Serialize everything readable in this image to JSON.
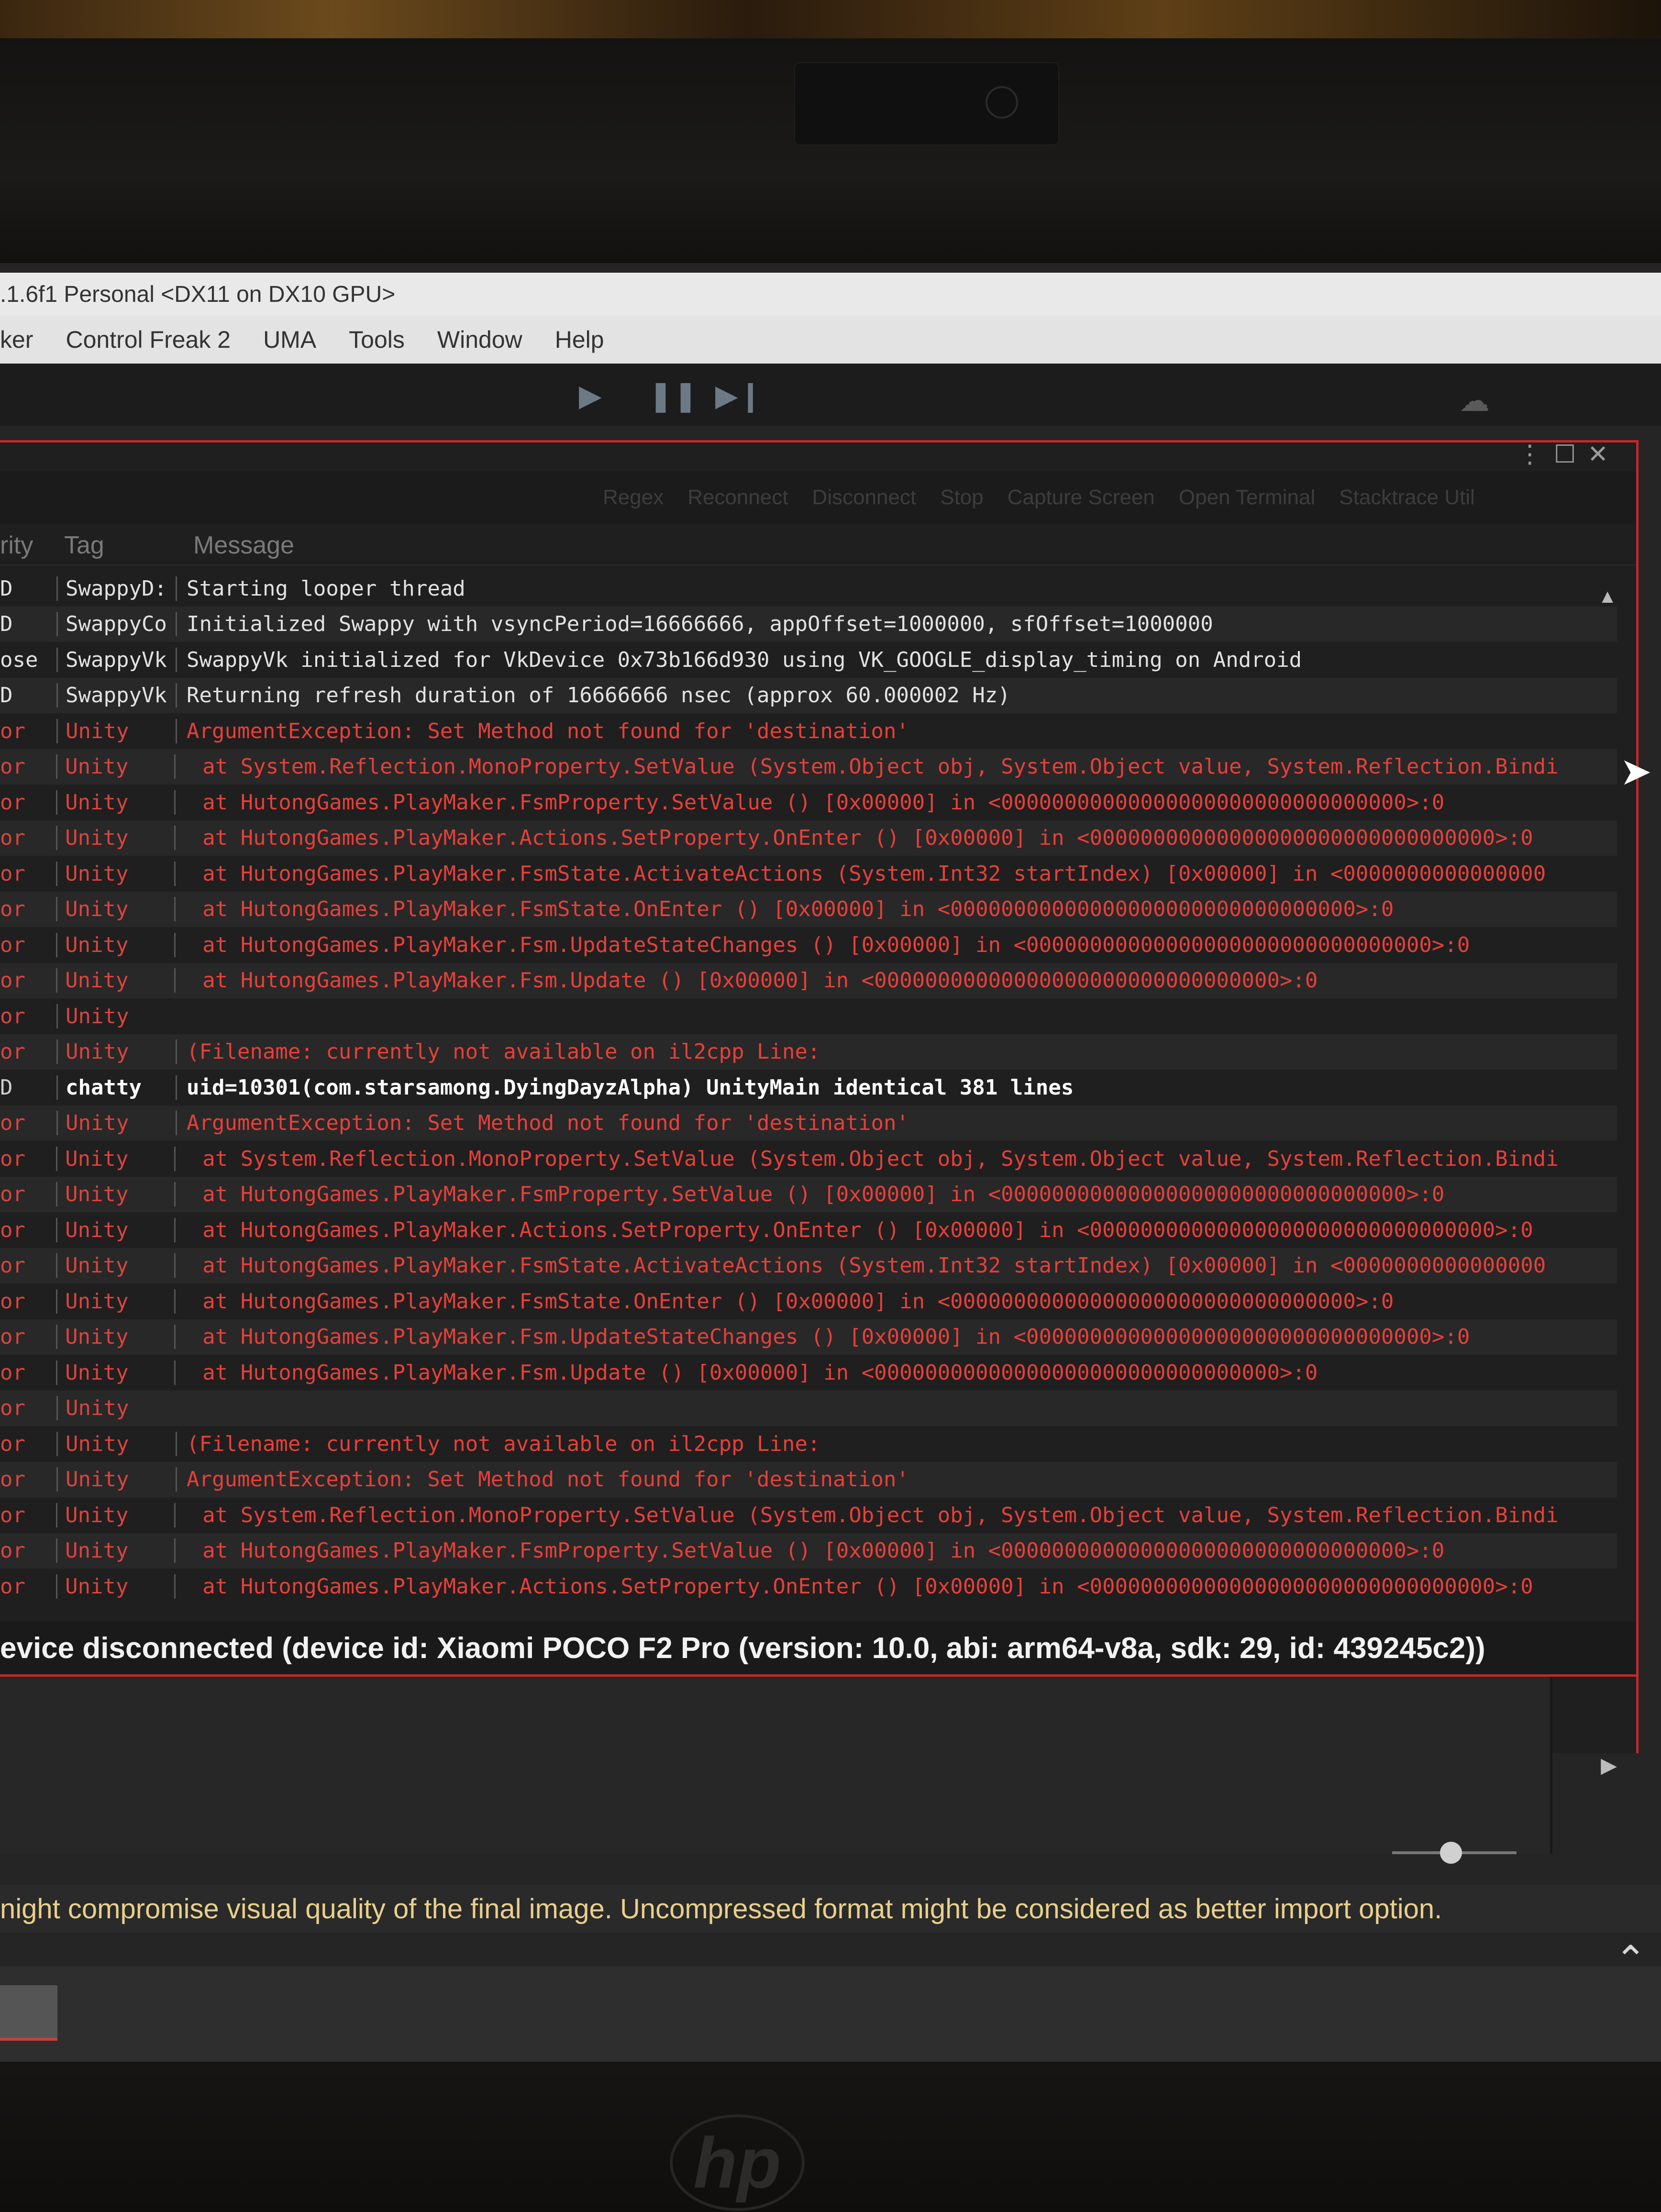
{
  "window": {
    "title": ".1.6f1 Personal <DX11 on DX10 GPU>"
  },
  "menu": [
    "ker",
    "Control Freak 2",
    "UMA",
    "Tools",
    "Window",
    "Help"
  ],
  "logcat": {
    "columns": {
      "priority": "rity",
      "tag": "Tag",
      "message": "Message"
    },
    "toolbar_buttons": [
      "Regex",
      "Reconnect",
      "Disconnect",
      "Stop",
      "Capture Screen",
      "Open Terminal",
      "Stacktrace Util"
    ],
    "rows": [
      {
        "p": "D",
        "tag": "SwappyD:",
        "msg": "Starting looper thread",
        "kind": "info",
        "indent": false
      },
      {
        "p": "D",
        "tag": "SwappyCo",
        "msg": "Initialized Swappy with vsyncPeriod=16666666, appOffset=1000000, sfOffset=1000000",
        "kind": "info",
        "indent": false
      },
      {
        "p": "ose",
        "tag": "SwappyVk",
        "msg": "SwappyVk initialized for VkDevice 0x73b166d930 using VK_GOOGLE_display_timing on Android",
        "kind": "info",
        "indent": false
      },
      {
        "p": "D",
        "tag": "SwappyVk",
        "msg": "Returning refresh duration of 16666666 nsec (approx 60.000002 Hz)",
        "kind": "info",
        "indent": false
      },
      {
        "p": "or",
        "tag": "Unity",
        "msg": "ArgumentException: Set Method not found for 'destination'",
        "kind": "err",
        "indent": false
      },
      {
        "p": "or",
        "tag": "Unity",
        "msg": "at System.Reflection.MonoProperty.SetValue (System.Object obj, System.Object value, System.Reflection.Bindi",
        "kind": "err",
        "indent": true
      },
      {
        "p": "or",
        "tag": "Unity",
        "msg": "at HutongGames.PlayMaker.FsmProperty.SetValue () [0x00000] in <00000000000000000000000000000000>:0",
        "kind": "err",
        "indent": true
      },
      {
        "p": "or",
        "tag": "Unity",
        "msg": "at HutongGames.PlayMaker.Actions.SetProperty.OnEnter () [0x00000] in <00000000000000000000000000000000>:0",
        "kind": "err",
        "indent": true
      },
      {
        "p": "or",
        "tag": "Unity",
        "msg": "at HutongGames.PlayMaker.FsmState.ActivateActions (System.Int32 startIndex) [0x00000] in <0000000000000000",
        "kind": "err",
        "indent": true
      },
      {
        "p": "or",
        "tag": "Unity",
        "msg": "at HutongGames.PlayMaker.FsmState.OnEnter () [0x00000] in <00000000000000000000000000000000>:0",
        "kind": "err",
        "indent": true
      },
      {
        "p": "or",
        "tag": "Unity",
        "msg": "at HutongGames.PlayMaker.Fsm.UpdateStateChanges () [0x00000] in <00000000000000000000000000000000>:0",
        "kind": "err",
        "indent": true
      },
      {
        "p": "or",
        "tag": "Unity",
        "msg": "at HutongGames.PlayMaker.Fsm.Update () [0x00000] in <00000000000000000000000000000000>:0",
        "kind": "err",
        "indent": true
      },
      {
        "p": "or",
        "tag": "Unity",
        "msg": "",
        "kind": "err",
        "indent": false
      },
      {
        "p": "or",
        "tag": "Unity",
        "msg": "(Filename: currently not available on il2cpp Line:",
        "kind": "err",
        "indent": false
      },
      {
        "p": "D",
        "tag": "chatty",
        "msg": "uid=10301(com.starsamong.DyingDayzAlpha) UnityMain identical 381 lines",
        "kind": "chatty",
        "indent": false
      },
      {
        "p": "or",
        "tag": "Unity",
        "msg": "ArgumentException: Set Method not found for 'destination'",
        "kind": "err",
        "indent": false
      },
      {
        "p": "or",
        "tag": "Unity",
        "msg": "at System.Reflection.MonoProperty.SetValue (System.Object obj, System.Object value, System.Reflection.Bindi",
        "kind": "err",
        "indent": true
      },
      {
        "p": "or",
        "tag": "Unity",
        "msg": "at HutongGames.PlayMaker.FsmProperty.SetValue () [0x00000] in <00000000000000000000000000000000>:0",
        "kind": "err",
        "indent": true
      },
      {
        "p": "or",
        "tag": "Unity",
        "msg": "at HutongGames.PlayMaker.Actions.SetProperty.OnEnter () [0x00000] in <00000000000000000000000000000000>:0",
        "kind": "err",
        "indent": true
      },
      {
        "p": "or",
        "tag": "Unity",
        "msg": "at HutongGames.PlayMaker.FsmState.ActivateActions (System.Int32 startIndex) [0x00000] in <0000000000000000",
        "kind": "err",
        "indent": true
      },
      {
        "p": "or",
        "tag": "Unity",
        "msg": "at HutongGames.PlayMaker.FsmState.OnEnter () [0x00000] in <00000000000000000000000000000000>:0",
        "kind": "err",
        "indent": true
      },
      {
        "p": "or",
        "tag": "Unity",
        "msg": "at HutongGames.PlayMaker.Fsm.UpdateStateChanges () [0x00000] in <00000000000000000000000000000000>:0",
        "kind": "err",
        "indent": true
      },
      {
        "p": "or",
        "tag": "Unity",
        "msg": "at HutongGames.PlayMaker.Fsm.Update () [0x00000] in <00000000000000000000000000000000>:0",
        "kind": "err",
        "indent": true
      },
      {
        "p": "or",
        "tag": "Unity",
        "msg": "",
        "kind": "err",
        "indent": false
      },
      {
        "p": "or",
        "tag": "Unity",
        "msg": "(Filename: currently not available on il2cpp Line:",
        "kind": "err",
        "indent": false
      },
      {
        "p": "or",
        "tag": "Unity",
        "msg": "ArgumentException: Set Method not found for 'destination'",
        "kind": "err",
        "indent": false
      },
      {
        "p": "or",
        "tag": "Unity",
        "msg": "at System.Reflection.MonoProperty.SetValue (System.Object obj, System.Object value, System.Reflection.Bindi",
        "kind": "err",
        "indent": true
      },
      {
        "p": "or",
        "tag": "Unity",
        "msg": "at HutongGames.PlayMaker.FsmProperty.SetValue () [0x00000] in <00000000000000000000000000000000>:0",
        "kind": "err",
        "indent": true
      },
      {
        "p": "or",
        "tag": "Unity",
        "msg": "at HutongGames.PlayMaker.Actions.SetProperty.OnEnter () [0x00000] in <00000000000000000000000000000000>:0",
        "kind": "err",
        "indent": true
      }
    ]
  },
  "status": {
    "device_line": "evice disconnected (device id: Xiaomi POCO F2 Pro (version: 10.0, abi: arm64-v8a, sdk: 29, id: 439245c2))",
    "warning_line": "night compromise visual quality of the final image. Uncompressed format might be considered as better import option."
  },
  "icons": {
    "play": "play-icon",
    "pause": "pause-icon",
    "step": "step-icon",
    "cloud": "cloud-icon",
    "menu": "kebab-icon",
    "maximize": "maximize-icon",
    "close": "close-icon",
    "scroll_up": "scroll-up-icon",
    "scroll_right": "scroll-right-icon",
    "chevron_up": "chevron-up-icon",
    "laptop_brand": "hp-logo"
  },
  "colors": {
    "error_text": "#e6403a",
    "panel_border": "#c02a2a",
    "warning_text": "#e8d08c"
  }
}
